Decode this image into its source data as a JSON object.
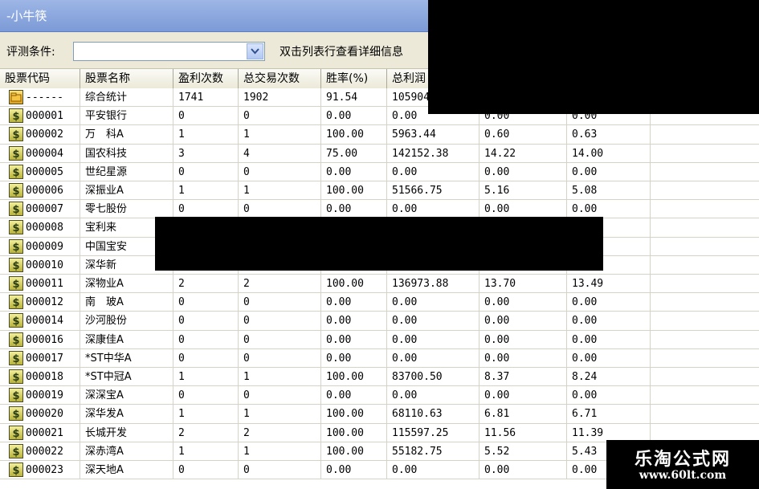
{
  "window": {
    "title": "-小牛筷"
  },
  "filter": {
    "label": "评测条件:",
    "value": "",
    "hint": "双击列表行查看详细信息"
  },
  "icons": {
    "stock": "dollar-stock-icon",
    "summary": "folder-icon",
    "dropdown": "chevron-down-icon"
  },
  "colors": {
    "titlebar": "#7c9ad6",
    "toolbar": "#ece9d8",
    "redaction": "#000000"
  },
  "table": {
    "columns": [
      "股票代码",
      "股票名称",
      "盈利次数",
      "总交易次数",
      "胜率(%)",
      "总利润",
      "",
      ""
    ],
    "rows": [
      {
        "icon": "folder",
        "cells": [
          "------",
          "综合统计",
          "1741",
          "1902",
          "91.54",
          "105904",
          "",
          ""
        ]
      },
      {
        "icon": "stock",
        "cells": [
          "000001",
          "平安银行",
          "0",
          "0",
          "0.00",
          "0.00",
          "0.00",
          "0.00"
        ]
      },
      {
        "icon": "stock",
        "cells": [
          "000002",
          "万　科A",
          "1",
          "1",
          "100.00",
          "5963.44",
          "0.60",
          "0.63"
        ]
      },
      {
        "icon": "stock",
        "cells": [
          "000004",
          "国农科技",
          "3",
          "4",
          "75.00",
          "142152.38",
          "14.22",
          "14.00"
        ]
      },
      {
        "icon": "stock",
        "cells": [
          "000005",
          "世纪星源",
          "0",
          "0",
          "0.00",
          "0.00",
          "0.00",
          "0.00"
        ]
      },
      {
        "icon": "stock",
        "cells": [
          "000006",
          "深振业A",
          "1",
          "1",
          "100.00",
          "51566.75",
          "5.16",
          "5.08"
        ]
      },
      {
        "icon": "stock",
        "cells": [
          "000007",
          "零七股份",
          "0",
          "0",
          "0.00",
          "0.00",
          "0.00",
          "0.00"
        ]
      },
      {
        "icon": "stock",
        "cells": [
          "000008",
          "宝利来",
          "",
          "",
          "",
          "",
          "",
          ""
        ]
      },
      {
        "icon": "stock",
        "cells": [
          "000009",
          "中国宝安",
          "",
          "",
          "",
          "",
          "",
          ""
        ]
      },
      {
        "icon": "stock",
        "cells": [
          "000010",
          "深华新",
          "",
          "",
          "",
          "",
          "",
          ""
        ]
      },
      {
        "icon": "stock",
        "cells": [
          "000011",
          "深物业A",
          "2",
          "2",
          "100.00",
          "136973.88",
          "13.70",
          "13.49"
        ]
      },
      {
        "icon": "stock",
        "cells": [
          "000012",
          "南　玻A",
          "0",
          "0",
          "0.00",
          "0.00",
          "0.00",
          "0.00"
        ]
      },
      {
        "icon": "stock",
        "cells": [
          "000014",
          "沙河股份",
          "0",
          "0",
          "0.00",
          "0.00",
          "0.00",
          "0.00"
        ]
      },
      {
        "icon": "stock",
        "cells": [
          "000016",
          "深康佳A",
          "0",
          "0",
          "0.00",
          "0.00",
          "0.00",
          "0.00"
        ]
      },
      {
        "icon": "stock",
        "cells": [
          "000017",
          "*ST中华A",
          "0",
          "0",
          "0.00",
          "0.00",
          "0.00",
          "0.00"
        ]
      },
      {
        "icon": "stock",
        "cells": [
          "000018",
          "*ST中冠A",
          "1",
          "1",
          "100.00",
          "83700.50",
          "8.37",
          "8.24"
        ]
      },
      {
        "icon": "stock",
        "cells": [
          "000019",
          "深深宝A",
          "0",
          "0",
          "0.00",
          "0.00",
          "0.00",
          "0.00"
        ]
      },
      {
        "icon": "stock",
        "cells": [
          "000020",
          "深华发A",
          "1",
          "1",
          "100.00",
          "68110.63",
          "6.81",
          "6.71"
        ]
      },
      {
        "icon": "stock",
        "cells": [
          "000021",
          "长城开发",
          "2",
          "2",
          "100.00",
          "115597.25",
          "11.56",
          "11.39"
        ]
      },
      {
        "icon": "stock",
        "cells": [
          "000022",
          "深赤湾A",
          "1",
          "1",
          "100.00",
          "55182.75",
          "5.52",
          "5.43"
        ]
      },
      {
        "icon": "stock",
        "cells": [
          "000023",
          "深天地A",
          "0",
          "0",
          "0.00",
          "0.00",
          "0.00",
          "0.00"
        ]
      }
    ]
  },
  "watermark": {
    "title": "乐淘公式网",
    "url": "www.60lt.com"
  }
}
